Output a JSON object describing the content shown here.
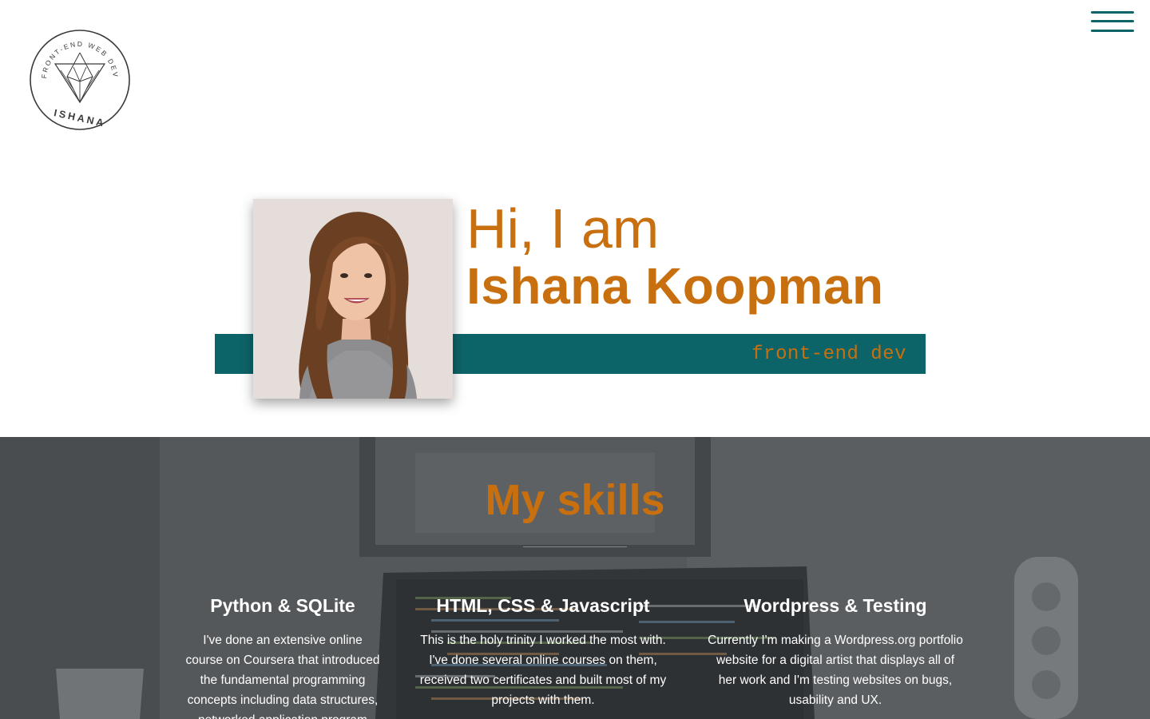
{
  "header": {
    "logo": {
      "ring_text": "FRONT-END WEB DEV",
      "brand_text": "ISHANA"
    },
    "menu_icon": "hamburger-menu-icon"
  },
  "hero": {
    "greeting": "Hi, I am",
    "name": "Ishana Koopman",
    "role": "front-end dev",
    "portrait": "profile-photo"
  },
  "skills": {
    "title": "My skills",
    "items": [
      {
        "title": "Python & SQLite",
        "text": "I've done an extensive online course on Coursera that introduced the fundamental programming concepts including data structures, networked application program interfaces, and"
      },
      {
        "title": "HTML, CSS & Javascript",
        "text": "This is the holy trinity I worked the most with. I've done several online courses on them, received two certificates and built most of my projects with them."
      },
      {
        "title": "Wordpress & Testing",
        "text": "Currently I'm making a Wordpress.org portfolio website for a digital artist that displays all of her work and I'm testing websites on bugs, usability and UX."
      }
    ]
  },
  "colors": {
    "accent_orange": "#c8700f",
    "accent_teal": "#0d6468",
    "background": "#ffffff",
    "skills_overlay": "#3e4144"
  }
}
